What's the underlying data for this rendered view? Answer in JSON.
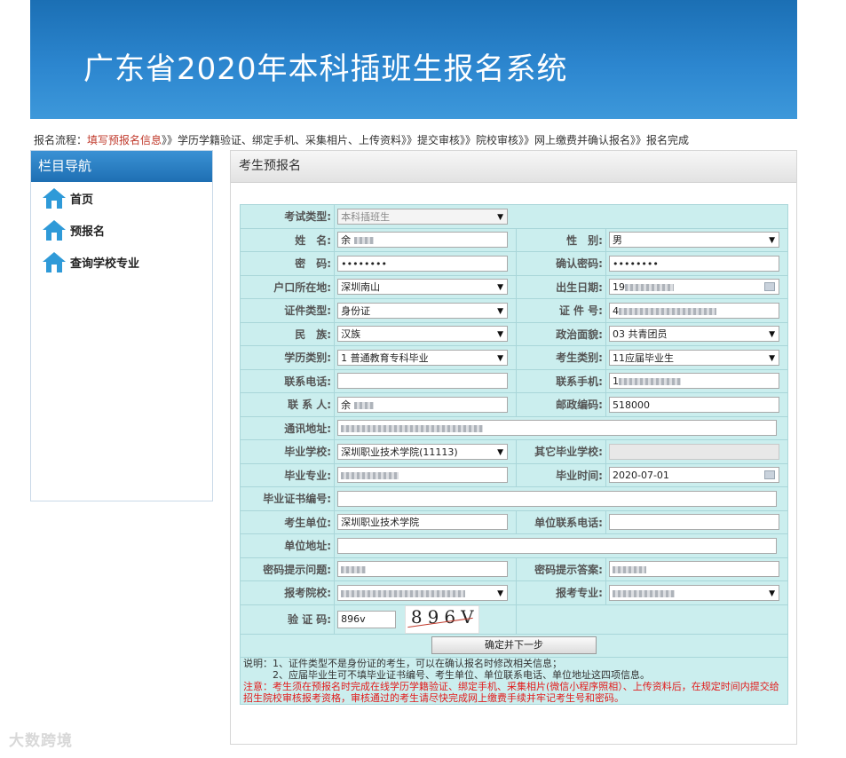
{
  "header": {
    "title": "广东省2020年本科插班生报名系统"
  },
  "flow": {
    "prefix": "报名流程：",
    "current": "填写预报名信息",
    "rest": "》》学历学籍验证、绑定手机、采集相片、上传资料》》提交审核》》院校审核》》网上缴费并确认报名》》报名完成"
  },
  "sidebar": {
    "title": "栏目导航",
    "items": [
      {
        "label": "首页"
      },
      {
        "label": "预报名"
      },
      {
        "label": "查询学校专业"
      }
    ]
  },
  "panel": {
    "title": "考生预报名"
  },
  "form": {
    "exam_type": {
      "label": "考试类型:",
      "value": "本科插班生"
    },
    "name": {
      "label": "姓　名:",
      "value": "余"
    },
    "gender": {
      "label": "性　别:",
      "value": "男"
    },
    "password": {
      "label": "密　码:",
      "value": "••••••••"
    },
    "confirm_password": {
      "label": "确认密码:",
      "value": "••••••••"
    },
    "hukou": {
      "label": "户口所在地:",
      "value": "深圳南山"
    },
    "birth": {
      "label": "出生日期:",
      "value": "19"
    },
    "id_type": {
      "label": "证件类型:",
      "value": "身份证"
    },
    "id_no": {
      "label": "证 件 号:",
      "value": "4"
    },
    "ethnic": {
      "label": "民　族:",
      "value": "汉族"
    },
    "political": {
      "label": "政治面貌:",
      "value": "03 共青团员"
    },
    "edu_type": {
      "label": "学历类别:",
      "value": "1 普通教育专科毕业"
    },
    "cand_type": {
      "label": "考生类别:",
      "value": "11应届毕业生"
    },
    "phone": {
      "label": "联系电话:",
      "value": ""
    },
    "mobile": {
      "label": "联系手机:",
      "value": "1"
    },
    "contact": {
      "label": "联 系 人:",
      "value": "余"
    },
    "postcode": {
      "label": "邮政编码:",
      "value": "518000"
    },
    "address": {
      "label": "通讯地址:",
      "value": ""
    },
    "school": {
      "label": "毕业学校:",
      "value": "深圳职业技术学院(11113)"
    },
    "other_school": {
      "label": "其它毕业学校:",
      "value": ""
    },
    "major": {
      "label": "毕业专业:",
      "value": ""
    },
    "grad_time": {
      "label": "毕业时间:",
      "value": "2020-07-01"
    },
    "cert_no": {
      "label": "毕业证书编号:",
      "value": ""
    },
    "employer": {
      "label": "考生单位:",
      "value": "深圳职业技术学院"
    },
    "employer_phone": {
      "label": "单位联系电话:",
      "value": ""
    },
    "employer_addr": {
      "label": "单位地址:",
      "value": ""
    },
    "pwd_question": {
      "label": "密码提示问题:",
      "value": ""
    },
    "pwd_answer": {
      "label": "密码提示答案:",
      "value": ""
    },
    "apply_school": {
      "label": "报考院校:",
      "value": ""
    },
    "apply_major": {
      "label": "报考专业:",
      "value": ""
    },
    "captcha": {
      "label": "验 证 码:",
      "value": "896v",
      "image_text": "896V"
    },
    "submit_label": "确定并下一步"
  },
  "notes": {
    "line1": "说明：1、证件类型不是身份证的考生，可以在确认报名时修改相关信息；",
    "line2": "　　　2、应届毕业生可不填毕业证书编号、考生单位、单位联系电话、单位地址这四项信息。",
    "warn": "注意：考生须在预报名时完成在线学历学籍验证、绑定手机、采集相片(微信小程序照相）、上传资料后，在规定时间内提交给招生院校审核报考资格，审核通过的考生请尽快完成网上缴费手续并牢记考生号和密码。"
  },
  "watermark": {
    "text": "大数跨境"
  },
  "colors": {
    "header": "#2c86cf",
    "table_bg": "#cbeeee",
    "warn": "#e21b1b"
  }
}
